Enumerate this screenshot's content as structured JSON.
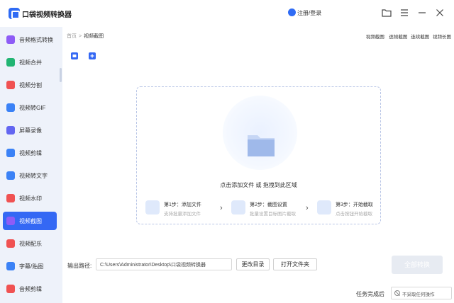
{
  "app": {
    "title": "口袋视频转换器",
    "login": "注册/登录"
  },
  "sidebar": {
    "items": [
      {
        "label": "音频格式转换",
        "icon": "audio-format-icon",
        "color": "#8e5cf6"
      },
      {
        "label": "视频合并",
        "icon": "video-merge-icon",
        "color": "#22b573"
      },
      {
        "label": "视频分割",
        "icon": "video-split-icon",
        "color": "#f05252"
      },
      {
        "label": "视频转GIF",
        "icon": "video-gif-icon",
        "color": "#3b82f6"
      },
      {
        "label": "屏幕录像",
        "icon": "screen-record-icon",
        "color": "#6366f1"
      },
      {
        "label": "视频剪辑",
        "icon": "video-edit-icon",
        "color": "#3b82f6"
      },
      {
        "label": "视频转文字",
        "icon": "video-text-icon",
        "color": "#3b82f6"
      },
      {
        "label": "视频水印",
        "icon": "video-watermark-icon",
        "color": "#f05252"
      },
      {
        "label": "视频截图",
        "icon": "video-screenshot-icon",
        "color": "#8e5cf6"
      },
      {
        "label": "视频配乐",
        "icon": "video-music-icon",
        "color": "#f05252"
      },
      {
        "label": "字幕/贴图",
        "icon": "subtitle-sticker-icon",
        "color": "#3b82f6"
      },
      {
        "label": "音频剪辑",
        "icon": "audio-edit-icon",
        "color": "#f05252"
      }
    ],
    "active_index": 8
  },
  "breadcrumb": {
    "home": "首页",
    "separator": ">",
    "current": "视频截图"
  },
  "right_links": [
    "视频截图:",
    "逐帧截图",
    "连续截图",
    "视频长图"
  ],
  "drop_zone": {
    "text": "点击添加文件 或 拖拽到此区域"
  },
  "steps": [
    {
      "title": "第1步：添加文件",
      "desc": "支持批量添加文件"
    },
    {
      "title": "第2步：截图设置",
      "desc": "批量设置目标图片截取"
    },
    {
      "title": "第3步：开始截取",
      "desc": "点击按钮开始截取"
    }
  ],
  "output": {
    "label": "输出路径:",
    "path": "C:\\Users\\Administrator\\Desktop\\口袋视频转换器",
    "change_dir": "更改目录",
    "open_folder": "打开文件夹",
    "convert_all": "全部转换"
  },
  "task": {
    "label": "任务完成后",
    "value": "不采取任何操作"
  },
  "colors": {
    "accent": "#3468f4",
    "sidebar_bg": "#eef2fa",
    "convert_disabled": "#e7ebf2"
  }
}
